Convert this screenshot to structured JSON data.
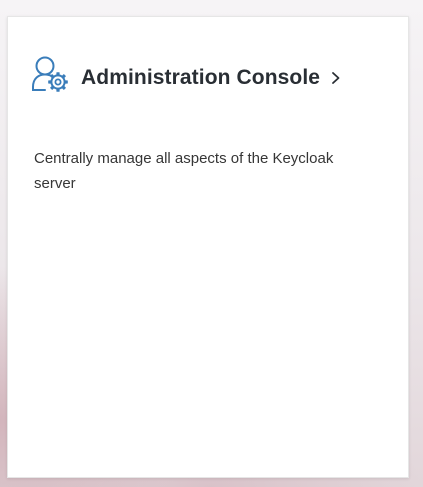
{
  "card": {
    "title": "Administration Console",
    "description": "Centrally manage all aspects of the Keycloak server",
    "icon": "admin-user-gear-icon",
    "link_icon": "chevron-right-icon",
    "accent_color": "#3a7dba"
  }
}
